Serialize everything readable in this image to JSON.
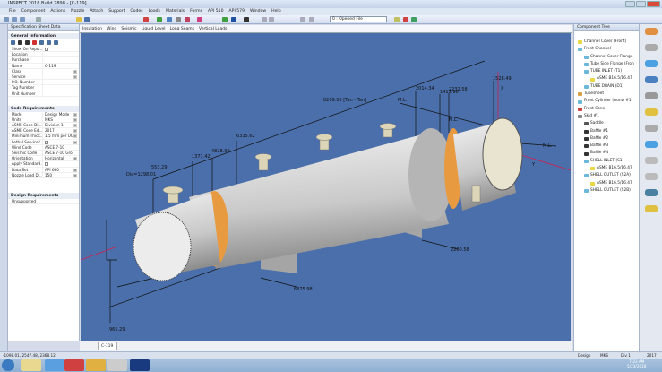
{
  "window": {
    "title": "INSPECT 2018 Build 7898 - [C-119]"
  },
  "menu": [
    "File",
    "Component",
    "Actions",
    "Nozzle",
    "Attach",
    "Support",
    "Codes",
    "Loads",
    "Materials",
    "Forms",
    "API 510",
    "API 579",
    "Window",
    "Help"
  ],
  "toolbar": {
    "opened_file": "0 : Opened File",
    "help_placeholder": "Type a question for help"
  },
  "left_panel": {
    "title": "Specification Sheet Data",
    "general": {
      "title": "General Information",
      "rows": [
        [
          "Show On Repo...",
          ""
        ],
        [
          "Location",
          ""
        ],
        [
          "Purchase",
          ""
        ],
        [
          "Name",
          "C-119"
        ],
        [
          "Class",
          ""
        ],
        [
          "Service",
          ""
        ],
        [
          "P.O. Number",
          ""
        ],
        [
          "Tag Number",
          ""
        ],
        [
          "Unit Number",
          ""
        ]
      ]
    },
    "code": {
      "title": "Code Requirements",
      "rows": [
        [
          "Mode",
          "Design Mode"
        ],
        [
          "Units",
          "MKS"
        ],
        [
          "ASME Code Di...",
          "Division 1"
        ],
        [
          "ASME Code Ed...",
          "2017"
        ],
        [
          "Minimum Thick...",
          "1.5 mm per UG"
        ],
        [
          "Lethal Service?",
          ""
        ],
        [
          "Wind Code",
          "ASCE 7-10"
        ],
        [
          "Seismic Code",
          "ASCE 7-10 Gro"
        ],
        [
          "Orientation",
          "Horizontal"
        ],
        [
          "Apply Standard...",
          ""
        ],
        [
          "Data Set",
          "API 660"
        ],
        [
          "Nozzle Load D...",
          "150"
        ]
      ]
    },
    "design": {
      "title": "Design Requirements",
      "item": "Unsupported"
    }
  },
  "viewport": {
    "tabs": [
      "Insulation",
      "Wind",
      "Seismic",
      "Liquid Level",
      "Long Seams",
      "Vertical Loads"
    ],
    "doc_tab": "C-119",
    "dimensions": {
      "tan": "8269.05 [Tan - Tan]",
      "dia": "Dia=1298.01",
      "d1": "553.29",
      "d2": "1371.42",
      "d3": "4828.90",
      "d4": "6335.62",
      "d5": "2014.34",
      "d6": "1415.96",
      "d7": "2232.58",
      "d8": "1528.49",
      "d9": "2280.58",
      "d10": "6875.98",
      "d11": "965.29",
      "ml": "M.L.",
      "x": "X",
      "y": "Y"
    }
  },
  "component_tree": {
    "title": "Component Tree",
    "items": [
      {
        "label": "Channel Cover (Front)",
        "depth": 0,
        "color": "#e8d840"
      },
      {
        "label": "Front Channel",
        "depth": 0,
        "color": "#6bb8d8"
      },
      {
        "label": "Channel Cover Flange",
        "depth": 1,
        "color": "#6bb8d8"
      },
      {
        "label": "Tube Side Flange (Fron",
        "depth": 1,
        "color": "#6bb8d8"
      },
      {
        "label": "TUBE INLET (T1)",
        "depth": 1,
        "color": "#6bb8d8"
      },
      {
        "label": "ASME B16.5/16.47",
        "depth": 2,
        "color": "#e8d840"
      },
      {
        "label": "TUBE DRAIN (D1)",
        "depth": 1,
        "color": "#6bb8d8"
      },
      {
        "label": "Tubesheet",
        "depth": 0,
        "color": "#d8a040"
      },
      {
        "label": "Front Cylinder (front) #1",
        "depth": 0,
        "color": "#6bb8d8"
      },
      {
        "label": "Front Cone",
        "depth": 0,
        "color": "#c84040"
      },
      {
        "label": "Skid #1",
        "depth": 0,
        "color": "#888888"
      },
      {
        "label": "Saddle",
        "depth": 1,
        "color": "#555555"
      },
      {
        "label": "Baffle #1",
        "depth": 1,
        "color": "#333333"
      },
      {
        "label": "Baffle #2",
        "depth": 1,
        "color": "#333333"
      },
      {
        "label": "Baffle #3",
        "depth": 1,
        "color": "#333333"
      },
      {
        "label": "Baffle #4",
        "depth": 1,
        "color": "#333333"
      },
      {
        "label": "SHELL INLET (S1)",
        "depth": 1,
        "color": "#6bb8d8"
      },
      {
        "label": "ASME B16.5/16.47",
        "depth": 2,
        "color": "#e8d840"
      },
      {
        "label": "SHELL OUTLET (S2A)",
        "depth": 1,
        "color": "#6bb8d8"
      },
      {
        "label": "ASME B16.5/16.47",
        "depth": 2,
        "color": "#e8d840"
      },
      {
        "label": "SHELL OUTLET (S2B)",
        "depth": 1,
        "color": "#6bb8d8"
      }
    ]
  },
  "status": {
    "coords": "-1098.01, 2547.48, 2368.12",
    "mode": "Design",
    "units": "MKS",
    "division": "Div 1",
    "year": "2017"
  },
  "taskbar": {
    "time": "7:23 AM",
    "date": "5/23/2018",
    "apps": [
      "start",
      "explorer",
      "ie",
      "chrome",
      "paint",
      "app",
      "photoshop"
    ]
  }
}
